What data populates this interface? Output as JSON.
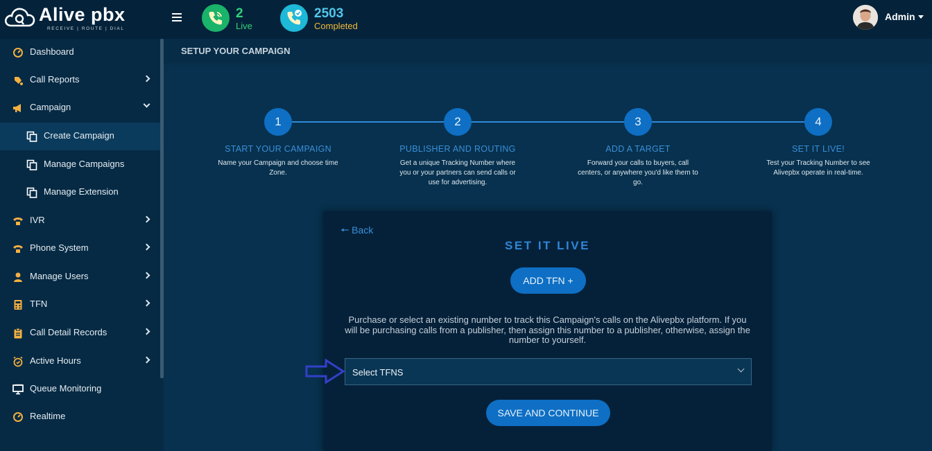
{
  "brand": {
    "name": "Alive pbx",
    "tagline": "RECEIVE | ROUTE | DIAL"
  },
  "header": {
    "stats": [
      {
        "value": "2",
        "label": "Live"
      },
      {
        "value": "2503",
        "label": "Completed"
      }
    ],
    "user": {
      "name": "Admin"
    }
  },
  "sidebar": {
    "items": [
      {
        "label": "Dashboard",
        "icon": "dashboard-icon",
        "expandable": false
      },
      {
        "label": "Call Reports",
        "icon": "call-reports-icon",
        "expandable": true
      },
      {
        "label": "Campaign",
        "icon": "megaphone-icon",
        "expandable": true,
        "expanded": true
      },
      {
        "label": "Create Campaign",
        "icon": "copy-icon",
        "sub": true,
        "active": true
      },
      {
        "label": "Manage Campaigns",
        "icon": "copy-icon",
        "sub": true
      },
      {
        "label": "Manage Extension",
        "icon": "copy-icon",
        "sub": true
      },
      {
        "label": "IVR",
        "icon": "ivr-icon",
        "expandable": true
      },
      {
        "label": "Phone System",
        "icon": "phone-system-icon",
        "expandable": true
      },
      {
        "label": "Manage Users",
        "icon": "user-icon",
        "expandable": true
      },
      {
        "label": "TFN",
        "icon": "calculator-icon",
        "expandable": true
      },
      {
        "label": "Call Detail Records",
        "icon": "clipboard-icon",
        "expandable": true
      },
      {
        "label": "Active Hours",
        "icon": "alarm-clock-icon",
        "expandable": true
      },
      {
        "label": "Queue Monitoring",
        "icon": "monitor-icon",
        "expandable": false
      },
      {
        "label": "Realtime",
        "icon": "realtime-icon",
        "expandable": false
      }
    ]
  },
  "page": {
    "title": "SETUP YOUR CAMPAIGN"
  },
  "steps": [
    {
      "number": "1",
      "title": "START YOUR CAMPAIGN",
      "desc": "Name your Campaign and choose time Zone."
    },
    {
      "number": "2",
      "title": "PUBLISHER AND ROUTING",
      "desc": "Get a unique Tracking Number where you or your partners can send calls or use for advertising."
    },
    {
      "number": "3",
      "title": "ADD A TARGET",
      "desc": "Forward your calls to buyers, call centers, or anywhere you'd like them to go."
    },
    {
      "number": "4",
      "title": "SET IT LIVE!",
      "desc": "Test your Tracking Number to see Alivepbx operate in real-time."
    }
  ],
  "card": {
    "back_label": "Back",
    "title": "SET IT LIVE",
    "add_tfn_label": "ADD TFN +",
    "description": "Purchase or select an existing number to track this Campaign's calls on the Alivepbx platform. If you will be purchasing calls from a publisher, then assign this number to a publisher, otherwise, assign the number to yourself.",
    "select_value": "Select TFNS",
    "save_label": "SAVE AND CONTINUE"
  },
  "colors": {
    "accent": "#0e6fc4",
    "accent_text": "#3a8fd9",
    "live": "#33d17a",
    "completed": "#f4b93b",
    "annotation_arrow": "#3340c8"
  }
}
